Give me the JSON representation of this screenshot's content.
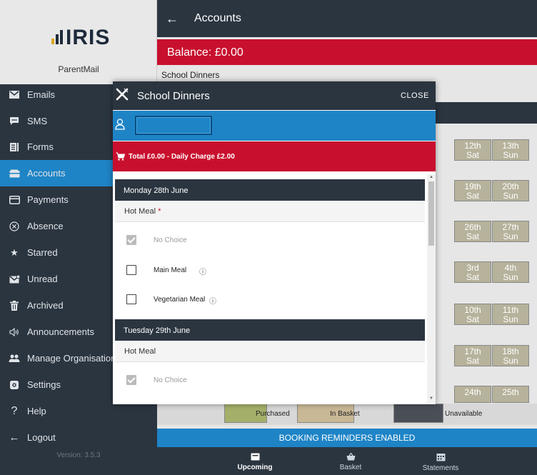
{
  "sidebar": {
    "logo_text": "IRIS",
    "logo_accent_color": "#d7a823",
    "app_name": "ParentMail",
    "items": [
      {
        "label": "Emails",
        "icon": "envelope-icon"
      },
      {
        "label": "SMS",
        "icon": "speech-bubble-icon"
      },
      {
        "label": "Forms",
        "icon": "form-icon"
      },
      {
        "label": "Accounts",
        "icon": "wallet-icon",
        "active": true
      },
      {
        "label": "Payments",
        "icon": "card-icon"
      },
      {
        "label": "Absence",
        "icon": "x-circle-icon"
      },
      {
        "label": "Starred",
        "icon": "star-icon"
      },
      {
        "label": "Unread",
        "icon": "unread-mail-icon"
      },
      {
        "label": "Archived",
        "icon": "trash-icon"
      },
      {
        "label": "Announcements",
        "icon": "speaker-icon"
      },
      {
        "label": "Manage Organisations",
        "icon": "people-icon"
      },
      {
        "label": "Settings",
        "icon": "gear-icon"
      },
      {
        "label": "Help",
        "icon": "question-icon"
      },
      {
        "label": "Logout",
        "icon": "arrow-left-icon"
      }
    ],
    "version": "Version: 3.5.3"
  },
  "header": {
    "back_icon": "arrow-left-icon",
    "title": "Accounts"
  },
  "balance": "Balance: £0.00",
  "section_label": "School Dinners",
  "calendar_cells": [
    {
      "a": "12th",
      "b": "Sat"
    },
    {
      "a": "13th",
      "b": "Sun"
    },
    {
      "a": "19th",
      "b": "Sat"
    },
    {
      "a": "20th",
      "b": "Sun"
    },
    {
      "a": "26th",
      "b": "Sat"
    },
    {
      "a": "27th",
      "b": "Sun"
    },
    {
      "a": "3rd",
      "b": "Sat"
    },
    {
      "a": "4th",
      "b": "Sun"
    },
    {
      "a": "10th",
      "b": "Sat"
    },
    {
      "a": "11th",
      "b": "Sun"
    },
    {
      "a": "17th",
      "b": "Sat"
    },
    {
      "a": "18th",
      "b": "Sun"
    },
    {
      "a": "24th",
      "b": ""
    },
    {
      "a": "25th",
      "b": ""
    }
  ],
  "legend": [
    {
      "label": "Purchased",
      "color": "#a4b06a"
    },
    {
      "label": "In Basket",
      "color": "#c9b896"
    },
    {
      "label": "Unavailable",
      "color": "#4a4f57"
    }
  ],
  "reminders": "BOOKING REMINDERS ENABLED",
  "bottom_nav": [
    {
      "label": "Upcoming",
      "icon": "calendar-list-icon",
      "active": true
    },
    {
      "label": "Basket",
      "icon": "basket-icon"
    },
    {
      "label": "Statements",
      "icon": "statement-icon"
    }
  ],
  "modal": {
    "title": "School Dinners",
    "close_label": "CLOSE",
    "name_value": "",
    "total_text": "Total £0.00 - Daily Charge £2.00",
    "days": [
      {
        "day": "Monday 28th June",
        "meal": "Hot Meal",
        "required_mark": "*",
        "options": [
          {
            "label": "No Choice",
            "checked": true,
            "disabled": true,
            "info": ""
          },
          {
            "label": "Main Meal",
            "checked": false,
            "disabled": false,
            "info": "ⓘ"
          },
          {
            "label": "Vegetarian Meal",
            "checked": false,
            "disabled": false,
            "info": "ⓘ"
          }
        ]
      },
      {
        "day": "Tuesday 29th June",
        "meal": "Hot Meal",
        "required_mark": "",
        "options": [
          {
            "label": "No Choice",
            "checked": true,
            "disabled": true,
            "info": ""
          }
        ]
      }
    ]
  },
  "colors": {
    "dark": "#2b3540",
    "blue": "#1e84c6",
    "red": "#c8102e"
  }
}
